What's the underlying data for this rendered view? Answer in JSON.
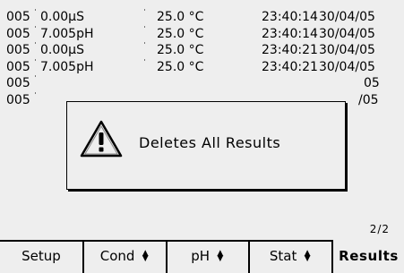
{
  "results": [
    {
      "num": "005",
      "mark": "˙",
      "value": "0.00µS",
      "mark2": "˙",
      "temp": "25.0 °C",
      "time": "23:40:14",
      "date": "30/04/05"
    },
    {
      "num": "005",
      "mark": "˙",
      "value": "7.005pH",
      "mark2": "˙",
      "temp": "25.0 °C",
      "time": "23:40:14",
      "date": "30/04/05"
    },
    {
      "num": "005",
      "mark": "˙",
      "value": "0.00µS",
      "mark2": "˙",
      "temp": "25.0 °C",
      "time": "23:40:21",
      "date": "30/04/05"
    },
    {
      "num": "005",
      "mark": "˙",
      "value": "7.005pH",
      "mark2": "˙",
      "temp": "25.0 °C",
      "time": "23:40:21",
      "date": "30/04/05"
    },
    {
      "num": "005",
      "mark": "˙",
      "value": "",
      "mark2": "",
      "temp": "",
      "time": "",
      "date": "05"
    },
    {
      "num": "005",
      "mark": "˙",
      "value": "",
      "mark2": "",
      "temp": "",
      "time": "",
      "date": "/05"
    }
  ],
  "dialog": {
    "icon": "warning-icon",
    "message": "Deletes All Results"
  },
  "page_indicator": "2/2",
  "tabs": [
    {
      "label": "Setup",
      "icon": ""
    },
    {
      "label": "Cond",
      "icon": "updown-arrow-icon"
    },
    {
      "label": "pH",
      "icon": "updown-arrow-icon"
    },
    {
      "label": "Stat",
      "icon": "updown-arrow-icon"
    },
    {
      "label": "Results",
      "icon": ""
    }
  ],
  "active_tab": "Results"
}
